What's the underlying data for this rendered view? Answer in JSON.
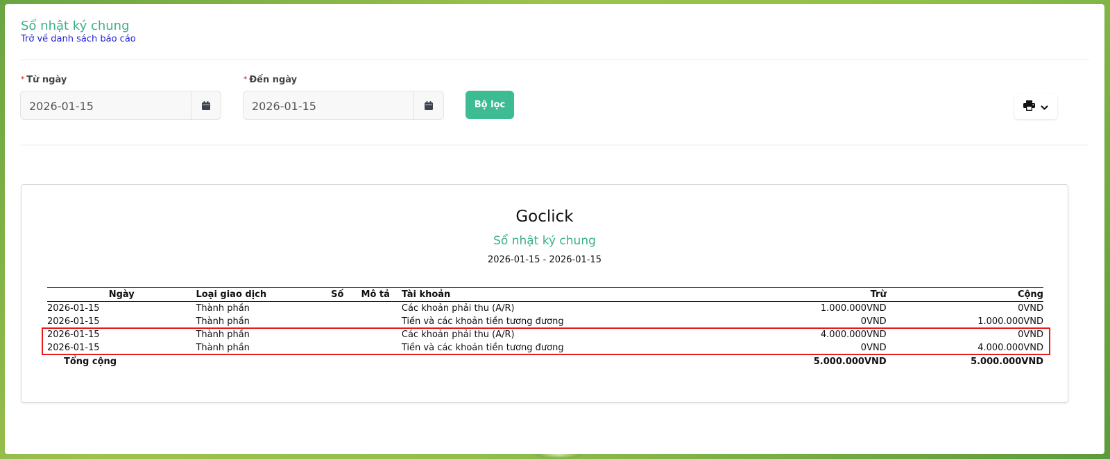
{
  "header": {
    "title": "Sổ nhật ký chung",
    "back_link": "Trở về danh sách báo cáo"
  },
  "filters": {
    "from_label": "Từ ngày",
    "from_value": "2026-01-15",
    "to_label": "Đến ngày",
    "to_value": "2026-01-15",
    "filter_button": "Bộ lọc",
    "print_icon": "printer-icon",
    "calendar_icon": "calendar-icon"
  },
  "report": {
    "company": "Goclick",
    "title": "Sổ nhật ký chung",
    "date_range": "2026-01-15 - 2026-01-15",
    "columns": {
      "date": "Ngày",
      "type": "Loại giao dịch",
      "number": "Số",
      "description": "Mô tả",
      "account": "Tài khoản",
      "debit": "Trừ",
      "credit": "Cộng"
    },
    "rows": [
      {
        "date": "2026-01-15",
        "type": "Thành phần",
        "number": "",
        "description": "",
        "account": "Các khoản phải thu (A/R)",
        "debit": "1.000.000VND",
        "credit": "0VND"
      },
      {
        "date": "2026-01-15",
        "type": "Thành phần",
        "number": "",
        "description": "",
        "account": "Tiền và các khoản tiền tương đương",
        "debit": "0VND",
        "credit": "1.000.000VND"
      },
      {
        "date": "2026-01-15",
        "type": "Thành phần",
        "number": "",
        "description": "",
        "account": "Các khoản phải thu (A/R)",
        "debit": "4.000.000VND",
        "credit": "0VND"
      },
      {
        "date": "2026-01-15",
        "type": "Thành phần",
        "number": "",
        "description": "",
        "account": "Tiền và các khoản tiền tương đương",
        "debit": "0VND",
        "credit": "4.000.000VND"
      }
    ],
    "total": {
      "label": "Tổng cộng",
      "debit": "5.000.000VND",
      "credit": "5.000.000VND"
    }
  },
  "colors": {
    "accent": "#3aaf8b",
    "button": "#3dbc94",
    "link": "#1f1fd6",
    "highlight": "#e81b1b"
  }
}
